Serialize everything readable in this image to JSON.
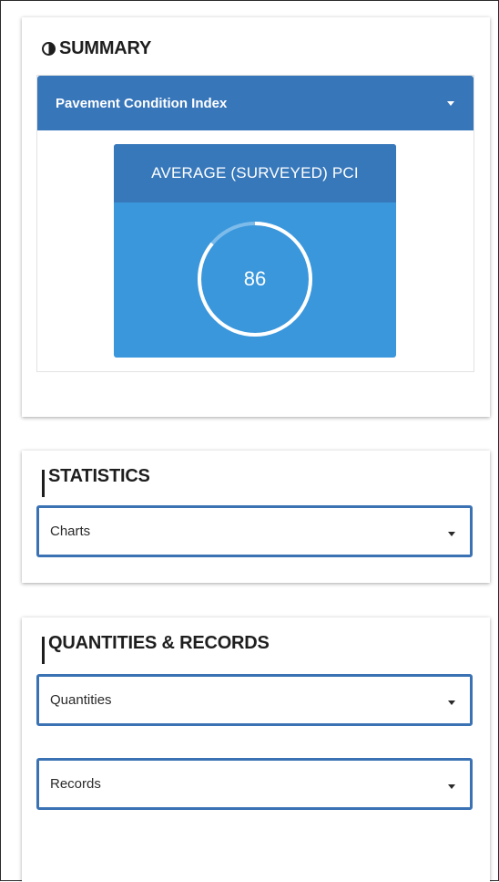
{
  "summary": {
    "title": "SUMMARY",
    "dropdown_label": "Pavement Condition Index",
    "tile_title": "AVERAGE (SURVEYED) PCI",
    "pci_value": "86",
    "gauge_fraction": 0.86,
    "icon": "half-circle-icon"
  },
  "statistics": {
    "title": "STATISTICS",
    "select_value": "Charts",
    "icon": "bar-chart-icon"
  },
  "quantities": {
    "title": "QUANTITIES & RECORDS",
    "quantities_value": "Quantities",
    "records_value": "Records",
    "icon": "bar-chart-icon"
  },
  "colors": {
    "header_blue": "#3876ba",
    "tile_blue": "#3a97dc",
    "tile_header_blue": "#3778bb",
    "select_border": "#3a72b4"
  }
}
